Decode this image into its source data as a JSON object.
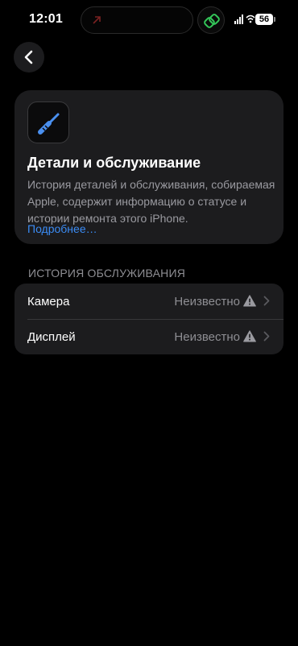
{
  "status_bar": {
    "time": "12:01",
    "battery": "56"
  },
  "nav": {
    "back_icon": "chevron-left-icon"
  },
  "info_card": {
    "icon": "screwdriver-icon",
    "title": "Детали и обслуживание",
    "description": "История деталей и обслуживания, собираемая Apple, содержит информацию о статусе и истории ремонта этого iPhone.",
    "link": "Подробнее…"
  },
  "service_history": {
    "header": "ИСТОРИЯ ОБСЛУЖИВАНИЯ",
    "items": [
      {
        "label": "Камера",
        "value": "Неизвестно",
        "icon": "warning-icon"
      },
      {
        "label": "Дисплей",
        "value": "Неизвестно",
        "icon": "warning-icon"
      }
    ]
  },
  "colors": {
    "background": "#000000",
    "card": "#1c1c1e",
    "link": "#3b8cf5",
    "secondary_text": "#8e8e93"
  }
}
